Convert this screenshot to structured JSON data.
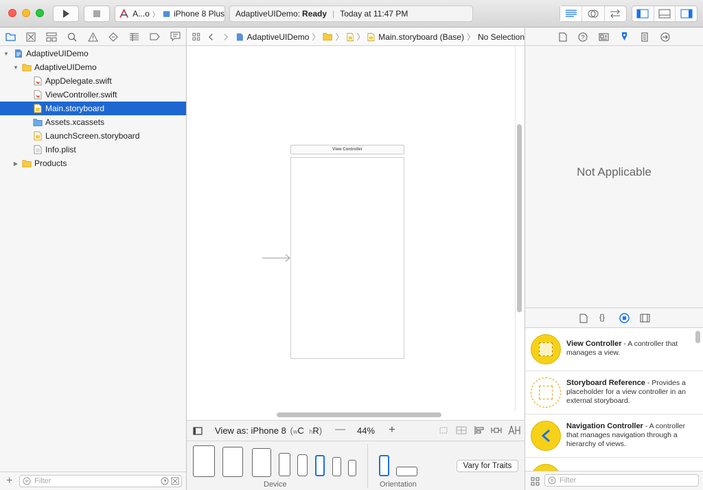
{
  "toolbar": {
    "scheme_target": "A...o",
    "device": "iPhone 8 Plus",
    "status_project": "AdaptiveUIDemo:",
    "status_state": "Ready",
    "status_time": "Today at 11:47 PM",
    "run_icon": "play-icon",
    "stop_icon": "stop-icon"
  },
  "navigator": {
    "items": [
      {
        "label": "AdaptiveUIDemo",
        "icon": "project-icon",
        "level": 0,
        "expanded": true
      },
      {
        "label": "AdaptiveUIDemo",
        "icon": "folder-icon",
        "level": 1,
        "expanded": true
      },
      {
        "label": "AppDelegate.swift",
        "icon": "swift-file-icon",
        "level": 2
      },
      {
        "label": "ViewController.swift",
        "icon": "swift-file-icon",
        "level": 2
      },
      {
        "label": "Main.storyboard",
        "icon": "storyboard-icon",
        "level": 2,
        "selected": true
      },
      {
        "label": "Assets.xcassets",
        "icon": "assets-icon",
        "level": 2
      },
      {
        "label": "LaunchScreen.storyboard",
        "icon": "storyboard-icon",
        "level": 2
      },
      {
        "label": "Info.plist",
        "icon": "plist-icon",
        "level": 2
      },
      {
        "label": "Products",
        "icon": "folder-icon",
        "level": 1,
        "expanded": false
      }
    ],
    "filter_placeholder": "Filter"
  },
  "jumpbar": {
    "crumbs": [
      "AdaptiveUIDemo",
      "Main.storyboard (Base)",
      "No Selection"
    ]
  },
  "canvas": {
    "scene_title": "View Controller"
  },
  "canvas_bottom": {
    "view_as": "View as: iPhone 8",
    "size_class_w": "w",
    "size_class_w_value": "C",
    "size_class_h": "h",
    "size_class_h_value": "R",
    "zoom": "44%"
  },
  "device_bar": {
    "device_label": "Device",
    "orientation_label": "Orientation",
    "vary_button": "Vary for Traits"
  },
  "inspector": {
    "empty_text": "Not Applicable"
  },
  "library": {
    "items": [
      {
        "title": "View Controller",
        "desc": " - A controller that manages a view."
      },
      {
        "title": "Storyboard Reference",
        "desc": " - Provides a placeholder for a view controller in an external storyboard."
      },
      {
        "title": "Navigation Controller",
        "desc": " - A controller that manages navigation through a hierarchy of views."
      }
    ],
    "filter_placeholder": "Filter"
  },
  "colors": {
    "selection": "#1e67d2",
    "accent": "#1a73e8",
    "library_yellow": "#f7d118"
  }
}
